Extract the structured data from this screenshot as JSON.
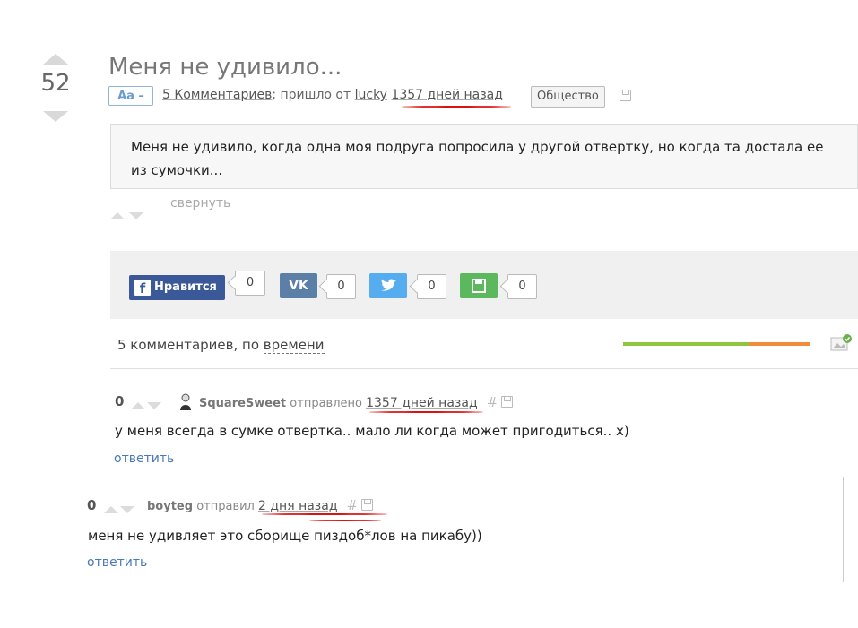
{
  "post": {
    "rating": "52",
    "title": "Меня не удивило...",
    "font_badge": "Aa –",
    "comments_link": "5 Комментариев",
    "from_prefix": "; пришло от",
    "author": "lucky",
    "time": "1357 дней назад",
    "tag": "Общество",
    "text": "Меня не удивило, когда одна моя подруга попросила у другой отвертку, но когда та достала ее из сумочки...",
    "collapse": "свернуть"
  },
  "share": {
    "fb_label": "Нравится",
    "fb_count": "0",
    "vk_label": "VK",
    "vk_count": "0",
    "tw_count": "0",
    "save_count": "0",
    "colors": {
      "fb": "#3b5998",
      "vk": "#5b7fa6",
      "tw": "#55acee",
      "save": "#5cb85c"
    }
  },
  "comments_header": {
    "prefix": "5 комментариев, по",
    "sort": "времени"
  },
  "comments": [
    {
      "rating": "0",
      "user": "SquareSweet",
      "verb": "отправлено",
      "time": "1357 дней назад",
      "hash": "#",
      "text": "у меня всегда в сумке отвертка.. мало ли когда может пригодиться.. х)",
      "reply": "ответить"
    },
    {
      "rating": "0",
      "user": "boyteg",
      "verb": "отправил",
      "time": "2 дня назад",
      "hash": "#",
      "text": "меня не удивляет это сборище пиздоб*лов на пикабу))",
      "reply": "ответить"
    }
  ]
}
